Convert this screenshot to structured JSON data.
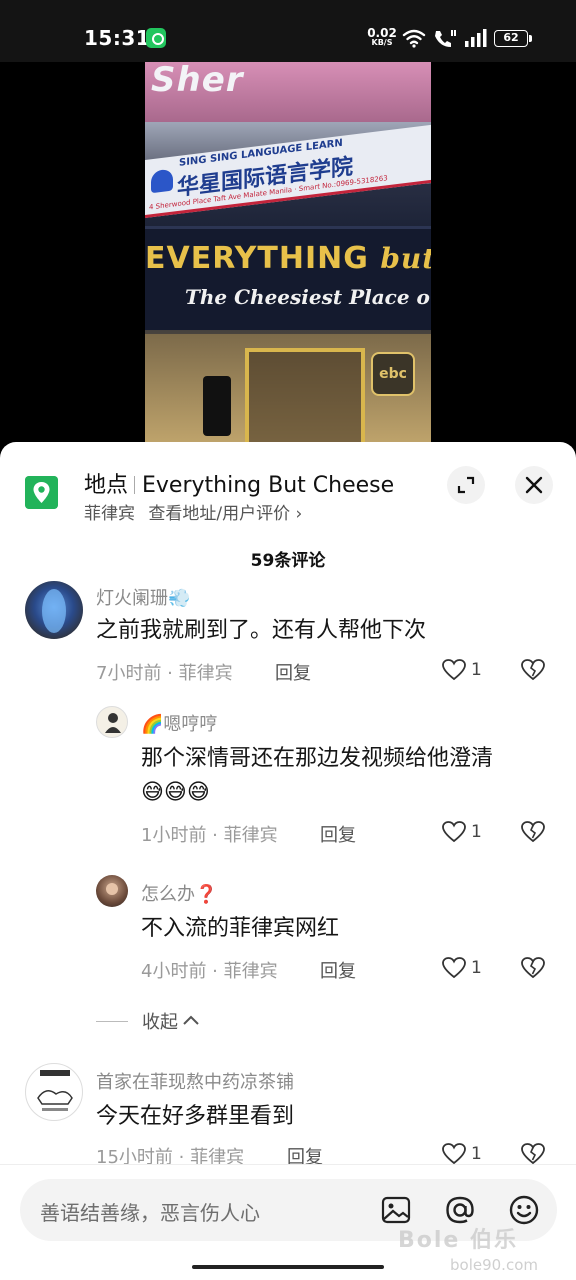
{
  "status_bar": {
    "time": "15:31",
    "net_speed_value": "0.02",
    "net_speed_unit": "KB/S",
    "battery": "62",
    "icons": [
      "app-notification-icon",
      "wifi-icon",
      "hd-call-icon",
      "signal-icon",
      "battery-icon"
    ]
  },
  "video": {
    "sign_top": "Sher",
    "school_en": "SING SING LANGUAGE LEARN",
    "school_cn": "华星国际语言学院",
    "school_addr": "4 Sherwood Place Taft Ave Malate Manila · Smart No.:0969-5318263",
    "ebc_line1_a": "EVERYTHING",
    "ebc_line1_b": "but C",
    "ebc_line2": "The Cheesiest Place on E",
    "mascot": "ebc"
  },
  "place": {
    "label": "地点",
    "name": "Everything But Cheese",
    "country": "菲律宾",
    "link": "查看地址/用户评价",
    "link_chevron": "›"
  },
  "comments_header": "59条评论",
  "comments": [
    {
      "user": "灯火阑珊",
      "user_suffix": "💨",
      "text": "之前我就刷到了。还有人帮他下次",
      "time": "7小时前",
      "location": "菲律宾",
      "reply_label": "回复",
      "likes": "1"
    },
    {
      "user": "嗯哼哼",
      "user_prefix": "🌈",
      "text": "那个深情哥还在那边发视频给他澄清",
      "text2": "😅😅😅",
      "time": "1小时前",
      "location": "菲律宾",
      "reply_label": "回复",
      "likes": "1"
    },
    {
      "user": "怎么办",
      "user_suffix": "❓",
      "text": "不入流的菲律宾网红",
      "time": "4小时前",
      "location": "菲律宾",
      "reply_label": "回复",
      "likes": "1"
    },
    {
      "user": "首家在菲现熬中药凉茶铺",
      "text": "今天在好多群里看到",
      "time": "15小时前",
      "location": "菲律宾",
      "reply_label": "回复",
      "likes": "1"
    }
  ],
  "collapse_label": "收起",
  "input": {
    "placeholder": "善语结善缘，恶言伤人心",
    "icons": [
      "image-icon",
      "at-icon",
      "emoji-icon"
    ]
  },
  "watermark": {
    "line1": "Bole 伯乐",
    "line2": "bole90.com"
  },
  "colors": {
    "place_green": "#22b35a",
    "text_primary": "#161616",
    "text_secondary": "#8a8a8a",
    "sheet_bg": "#ffffff"
  }
}
